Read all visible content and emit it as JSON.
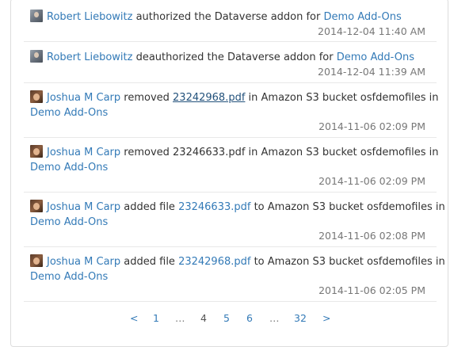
{
  "log": [
    {
      "user": "Robert Liebowitz",
      "avatar": "rl",
      "pre": " authorized the Dataverse addon for ",
      "link": "Demo Add-Ons",
      "post": "",
      "time": "2014-12-04 11:40 AM"
    },
    {
      "user": "Robert Liebowitz",
      "avatar": "rl",
      "pre": " deauthorized the Dataverse addon for ",
      "link": "Demo Add-Ons",
      "post": "",
      "time": "2014-12-04 11:39 AM"
    },
    {
      "user": "Joshua M Carp",
      "avatar": "jc",
      "pre": " removed ",
      "file": "23242968.pdf",
      "mid": " in Amazon S3 bucket osfdemofiles in",
      "project": "Demo Add-Ons",
      "time": "2014-11-06 02:09 PM"
    },
    {
      "user": "Joshua M Carp",
      "avatar": "jc",
      "pre": " removed 23246633.pdf in Amazon S3 bucket osfdemofiles in",
      "project": "Demo Add-Ons",
      "time": "2014-11-06 02:09 PM"
    },
    {
      "user": "Joshua M Carp",
      "avatar": "jc",
      "pre": " added file ",
      "file": "23246633.pdf",
      "mid": " to Amazon S3 bucket osfdemofiles in",
      "project": "Demo Add-Ons",
      "time": "2014-11-06 02:08 PM"
    },
    {
      "user": "Joshua M Carp",
      "avatar": "jc",
      "pre": " added file ",
      "file": "23242968.pdf",
      "mid": " to Amazon S3 bucket osfdemofiles in",
      "project": "Demo Add-Ons",
      "time": "2014-11-06 02:05 PM"
    }
  ],
  "pager": {
    "prev": "<",
    "p1": "1",
    "dots1": "…",
    "p4": "4",
    "p5": "5",
    "p6": "6",
    "dots2": "…",
    "p32": "32",
    "next": ">"
  },
  "colors": {
    "link": "#337ab7",
    "muted": "#777777",
    "border": "#dddddd"
  }
}
